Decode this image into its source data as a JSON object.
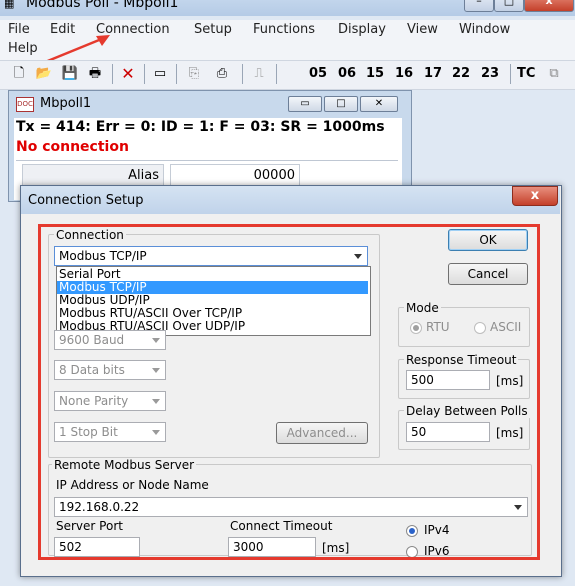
{
  "app": {
    "title": "Modbus Poll - Mbpoll1"
  },
  "menu": [
    "File",
    "Edit",
    "Connection",
    "Setup",
    "Functions",
    "Display",
    "View",
    "Window",
    "Help"
  ],
  "toolbar": {
    "func_codes": [
      "05",
      "06",
      "15",
      "16",
      "17",
      "22",
      "23"
    ],
    "tc": "TC"
  },
  "child": {
    "title": "Mbpoll1",
    "icon_text": "DOC",
    "status": "Tx = 414: Err = 0: ID = 1: F = 03: SR = 1000ms",
    "no_connection": "No connection",
    "col_alias": "Alias",
    "col_value": "00000"
  },
  "dialog": {
    "title": "Connection Setup",
    "close": "x",
    "connection_group": "Connection",
    "connection_selected": "Modbus TCP/IP",
    "connection_options": [
      "Serial Port",
      "Modbus TCP/IP",
      "Modbus UDP/IP",
      "Modbus RTU/ASCII Over TCP/IP",
      "Modbus RTU/ASCII Over UDP/IP"
    ],
    "selected_index": 1,
    "baud": "9600 Baud",
    "data_bits": "8 Data bits",
    "parity": "None Parity",
    "stop_bits": "1 Stop Bit",
    "advanced": "Advanced...",
    "ok": "OK",
    "cancel": "Cancel",
    "mode_group": "Mode",
    "mode_rtu": "RTU",
    "mode_ascii": "ASCII",
    "response_timeout_group": "Response Timeout",
    "response_timeout_value": "500",
    "response_timeout_unit": "[ms]",
    "delay_group": "Delay Between Polls",
    "delay_value": "50",
    "delay_unit": "[ms]",
    "remote_group": "Remote Modbus Server",
    "ip_label": "IP Address or Node Name",
    "ip_value": "192.168.0.22",
    "port_label": "Server Port",
    "port_value": "502",
    "connect_timeout_label": "Connect Timeout",
    "connect_timeout_value": "3000",
    "connect_timeout_unit": "[ms]",
    "ipv4": "IPv4",
    "ipv6": "IPv6"
  },
  "colors": {
    "highlight": "#e53a2e",
    "selection": "#3399ff",
    "no_connection": "#e00000"
  }
}
